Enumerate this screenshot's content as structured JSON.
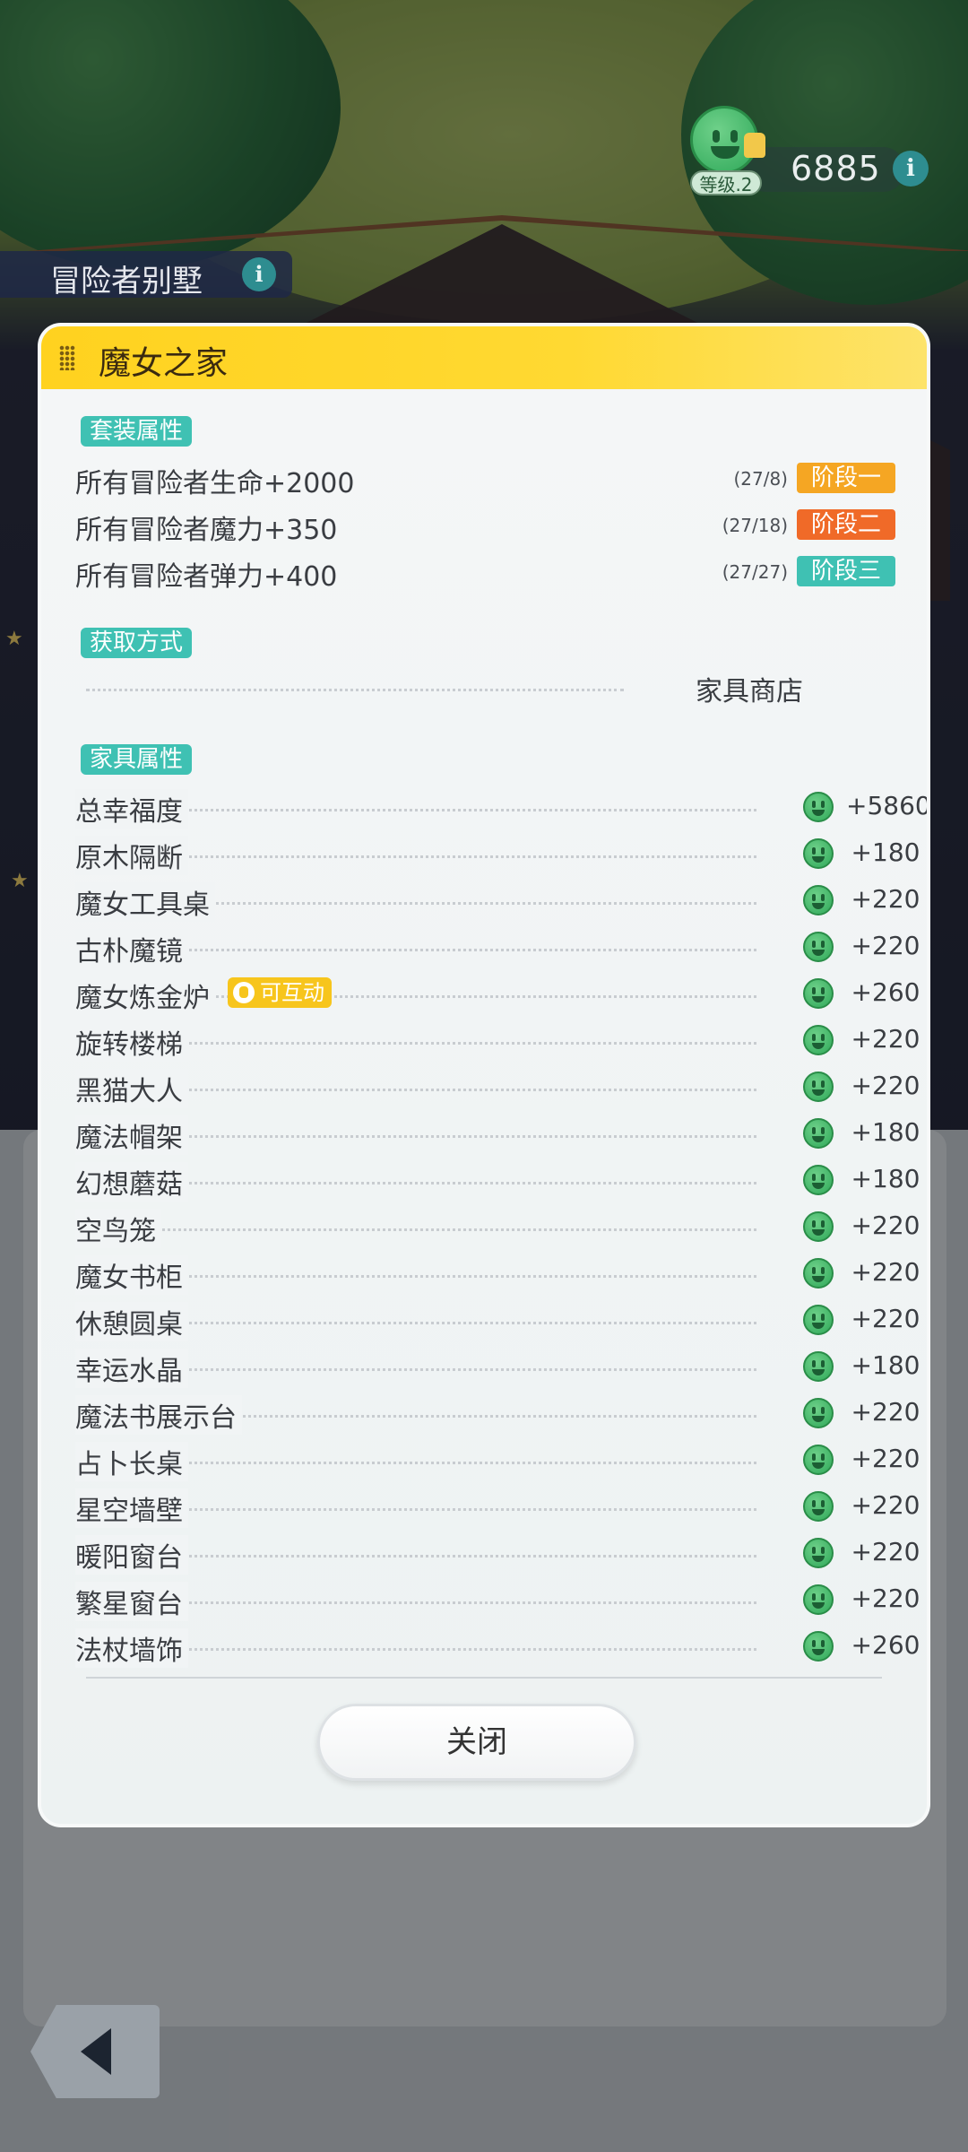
{
  "hud": {
    "level_label": "等级.2",
    "score": "6885",
    "info": "i"
  },
  "location": {
    "name": "冒险者别墅",
    "info": "i"
  },
  "modal": {
    "title": "魔女之家",
    "set_section": "套装属性",
    "set_bonuses": [
      {
        "name": "所有冒险者生命+2000",
        "progress": "(27/8)",
        "stage": "阶段一",
        "color": "#f5a623"
      },
      {
        "name": "所有冒险者魔力+350",
        "progress": "(27/18)",
        "stage": "阶段二",
        "color": "#f06a28"
      },
      {
        "name": "所有冒险者弹力+400",
        "progress": "(27/27)",
        "stage": "阶段三",
        "color": "#3fc1b3"
      }
    ],
    "source_section": "获取方式",
    "source_value": "家具商店",
    "furniture_section": "家具属性",
    "furniture": [
      {
        "name": "总幸福度",
        "value": "+5860"
      },
      {
        "name": "原木隔断",
        "value": "+180"
      },
      {
        "name": "魔女工具桌",
        "value": "+220"
      },
      {
        "name": "古朴魔镜",
        "value": "+220"
      },
      {
        "name": "魔女炼金炉",
        "value": "+260",
        "badge": "可互动"
      },
      {
        "name": "旋转楼梯",
        "value": "+220"
      },
      {
        "name": "黑猫大人",
        "value": "+220"
      },
      {
        "name": "魔法帽架",
        "value": "+180"
      },
      {
        "name": "幻想蘑菇",
        "value": "+180"
      },
      {
        "name": "空鸟笼",
        "value": "+220"
      },
      {
        "name": "魔女书柜",
        "value": "+220"
      },
      {
        "name": "休憩圆桌",
        "value": "+220"
      },
      {
        "name": "幸运水晶",
        "value": "+180"
      },
      {
        "name": "魔法书展示台",
        "value": "+220"
      },
      {
        "name": "占卜长桌",
        "value": "+220"
      },
      {
        "name": "星空墙壁",
        "value": "+220"
      },
      {
        "name": "暖阳窗台",
        "value": "+220"
      },
      {
        "name": "繁星窗台",
        "value": "+220"
      },
      {
        "name": "法杖墙饰",
        "value": "+260"
      }
    ],
    "close_label": "关闭"
  },
  "colors": {
    "header_yellow": "#ffd21f",
    "tag_teal": "#3fc1b3",
    "interact_yellow": "#f7c51c"
  }
}
